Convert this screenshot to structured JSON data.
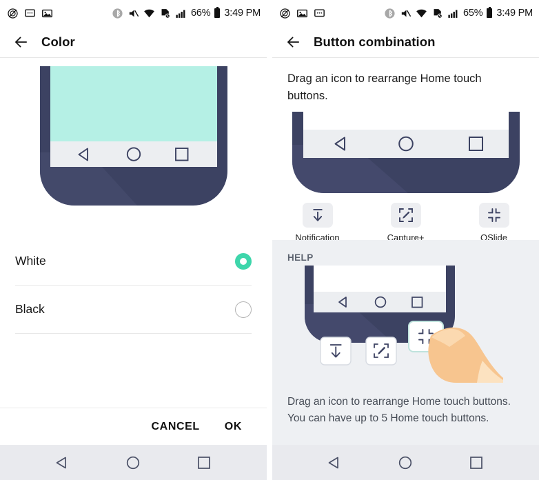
{
  "left_screen": {
    "status_bar": {
      "icons": [
        "mute-ring-icon",
        "message-icon",
        "image-icon"
      ],
      "right_icons": [
        "bluetooth-icon",
        "vibrate-off-icon",
        "wifi-icon",
        "sd-card-off-icon",
        "signal-bars-icon"
      ],
      "battery_percent": "66%",
      "time": "3:49 PM"
    },
    "app_bar": {
      "back": "back-arrow-icon",
      "title": "Color"
    },
    "preview": {
      "screen_color": "#b5f0e5",
      "frame_color": "#3c4262",
      "navbar_color": "#eceef1",
      "nav_icons": [
        "back-triangle-icon",
        "home-circle-icon",
        "recents-square-icon"
      ]
    },
    "options": [
      {
        "label": "White",
        "selected": true
      },
      {
        "label": "Black",
        "selected": false
      }
    ],
    "accent_color": "#3ed6ab",
    "actions": {
      "cancel": "CANCEL",
      "ok": "OK"
    },
    "navbar": [
      "back-triangle-icon",
      "home-circle-icon",
      "recents-square-icon"
    ]
  },
  "right_screen": {
    "status_bar": {
      "icons": [
        "mute-ring-icon",
        "image-icon",
        "message-icon"
      ],
      "right_icons": [
        "bluetooth-icon",
        "vibrate-off-icon",
        "wifi-icon",
        "sd-card-off-icon",
        "signal-bars-icon"
      ],
      "battery_percent": "65%",
      "time": "3:49 PM"
    },
    "app_bar": {
      "back": "back-arrow-icon",
      "title": "Button combination"
    },
    "instruction": "Drag an icon to rearrange Home touch buttons.",
    "preview": {
      "frame_color": "#3c4262",
      "navbar_color": "#eceef1",
      "nav_icons": [
        "back-triangle-icon",
        "home-circle-icon",
        "recents-square-icon"
      ]
    },
    "tray": [
      {
        "label": "Notification",
        "icon": "notification-pull-down-icon"
      },
      {
        "label": "Capture+",
        "icon": "capture-plus-pencil-icon"
      },
      {
        "label": "QSlide",
        "icon": "qslide-collapse-icon"
      }
    ],
    "help": {
      "title": "HELP",
      "illustration": {
        "hand_color": "#f7c58f",
        "highlight_tile": "qslide-collapse-icon",
        "tiles": [
          "notification-pull-down-icon",
          "capture-plus-pencil-icon",
          "qslide-collapse-icon"
        ]
      },
      "text": "Drag an icon to rearrange Home touch buttons. You can have up to 5 Home touch buttons."
    },
    "navbar": [
      "back-triangle-icon",
      "home-circle-icon",
      "recents-square-icon"
    ]
  }
}
